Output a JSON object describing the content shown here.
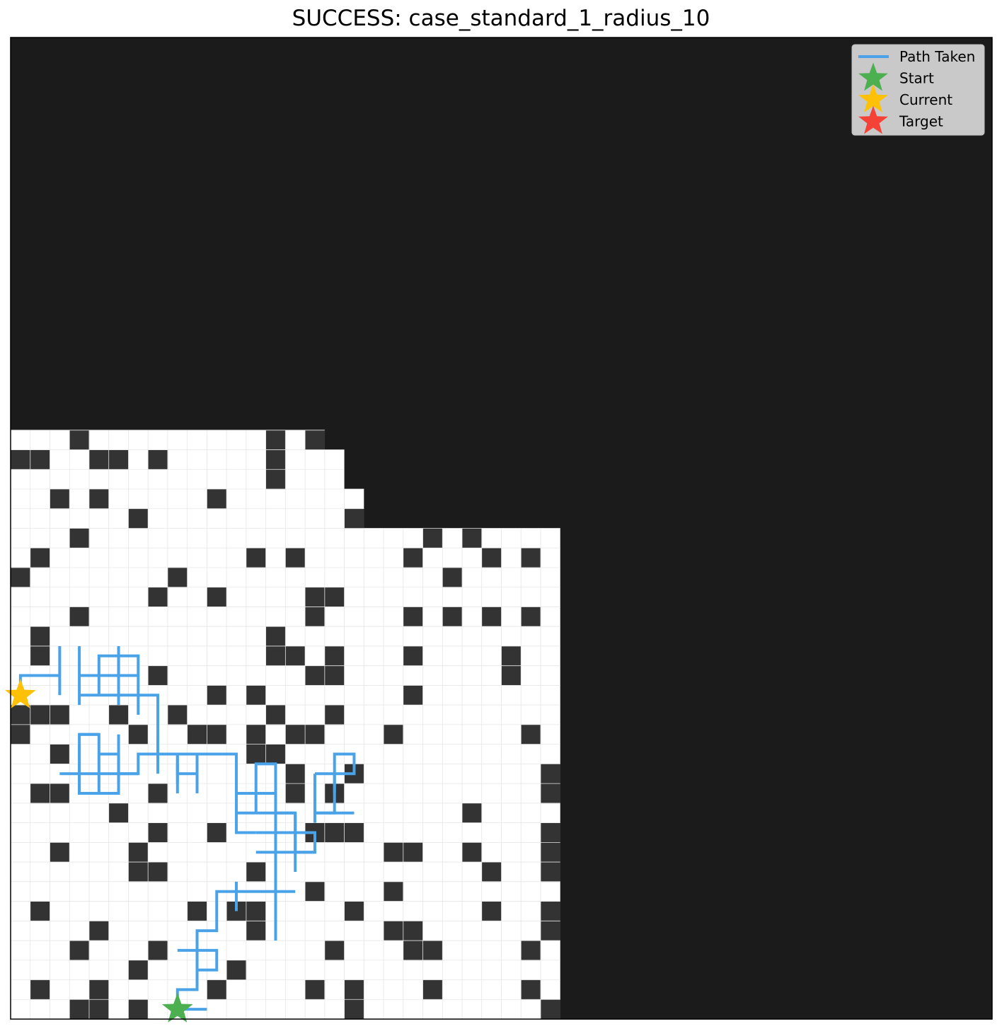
{
  "chart_data": {
    "type": "heatmap",
    "title": "SUCCESS: case_standard_1_radius_10",
    "grid_size": [
      50,
      50
    ],
    "grid": true,
    "legend_placement": "top-right",
    "legend": [
      {
        "label": "Path Taken",
        "kind": "line",
        "color": "#4aa3e8"
      },
      {
        "label": "Start",
        "kind": "star",
        "color": "#4caf50"
      },
      {
        "label": "Current",
        "kind": "star",
        "color": "#ffc107"
      },
      {
        "label": "Target",
        "kind": "star",
        "color": "#f44336"
      }
    ],
    "colors": {
      "unknown": "#1b1b1b",
      "free": "#ffffff",
      "obstacle": "#333333",
      "gridline": "#e6e6e6",
      "path": "#4aa3e8"
    },
    "revealed_rows": [
      {
        "row": 20,
        "end": 16
      },
      {
        "row": 21,
        "end": 17
      },
      {
        "row": 22,
        "end": 17
      },
      {
        "row": 23,
        "end": 18
      },
      {
        "row": 24,
        "end": 18
      },
      {
        "row": 25,
        "end": 28
      },
      {
        "row": 26,
        "end": 28
      },
      {
        "row": 27,
        "end": 28
      },
      {
        "row": 28,
        "end": 28
      },
      {
        "row": 29,
        "end": 28
      },
      {
        "row": 30,
        "end": 28
      },
      {
        "row": 31,
        "end": 28
      },
      {
        "row": 32,
        "end": 28
      },
      {
        "row": 33,
        "end": 28
      },
      {
        "row": 34,
        "end": 28
      },
      {
        "row": 35,
        "end": 28
      },
      {
        "row": 36,
        "end": 28
      },
      {
        "row": 37,
        "end": 28
      },
      {
        "row": 38,
        "end": 28
      },
      {
        "row": 39,
        "end": 28
      },
      {
        "row": 40,
        "end": 28
      },
      {
        "row": 41,
        "end": 28
      },
      {
        "row": 42,
        "end": 28
      },
      {
        "row": 43,
        "end": 28
      },
      {
        "row": 44,
        "end": 28
      },
      {
        "row": 45,
        "end": 28
      },
      {
        "row": 46,
        "end": 28
      },
      {
        "row": 47,
        "end": 28
      },
      {
        "row": 48,
        "end": 28
      },
      {
        "row": 49,
        "end": 28
      }
    ],
    "obstacles": [
      [
        20,
        3
      ],
      [
        20,
        13
      ],
      [
        20,
        15
      ],
      [
        21,
        0
      ],
      [
        21,
        1
      ],
      [
        21,
        4
      ],
      [
        21,
        5
      ],
      [
        21,
        7
      ],
      [
        21,
        13
      ],
      [
        22,
        13
      ],
      [
        23,
        2
      ],
      [
        23,
        4
      ],
      [
        23,
        10
      ],
      [
        24,
        6
      ],
      [
        24,
        17
      ],
      [
        25,
        3
      ],
      [
        25,
        21
      ],
      [
        25,
        23
      ],
      [
        26,
        1
      ],
      [
        26,
        12
      ],
      [
        26,
        14
      ],
      [
        26,
        20
      ],
      [
        26,
        24
      ],
      [
        26,
        26
      ],
      [
        27,
        0
      ],
      [
        27,
        8
      ],
      [
        27,
        22
      ],
      [
        28,
        7
      ],
      [
        28,
        10
      ],
      [
        28,
        15
      ],
      [
        28,
        16
      ],
      [
        29,
        3
      ],
      [
        29,
        15
      ],
      [
        29,
        20
      ],
      [
        29,
        22
      ],
      [
        29,
        24
      ],
      [
        29,
        26
      ],
      [
        30,
        1
      ],
      [
        30,
        13
      ],
      [
        31,
        1
      ],
      [
        31,
        13
      ],
      [
        31,
        14
      ],
      [
        31,
        16
      ],
      [
        31,
        20
      ],
      [
        31,
        25
      ],
      [
        32,
        7
      ],
      [
        32,
        15
      ],
      [
        32,
        16
      ],
      [
        32,
        25
      ],
      [
        33,
        10
      ],
      [
        33,
        12
      ],
      [
        33,
        20
      ],
      [
        34,
        0
      ],
      [
        34,
        1
      ],
      [
        34,
        2
      ],
      [
        34,
        5
      ],
      [
        34,
        8
      ],
      [
        34,
        13
      ],
      [
        34,
        16
      ],
      [
        35,
        0
      ],
      [
        35,
        6
      ],
      [
        35,
        9
      ],
      [
        35,
        10
      ],
      [
        35,
        12
      ],
      [
        35,
        14
      ],
      [
        35,
        15
      ],
      [
        35,
        19
      ],
      [
        35,
        26
      ],
      [
        36,
        2
      ],
      [
        36,
        12
      ],
      [
        36,
        13
      ],
      [
        37,
        14
      ],
      [
        37,
        17
      ],
      [
        37,
        27
      ],
      [
        38,
        1
      ],
      [
        38,
        2
      ],
      [
        38,
        7
      ],
      [
        38,
        14
      ],
      [
        38,
        16
      ],
      [
        38,
        27
      ],
      [
        39,
        5
      ],
      [
        39,
        23
      ],
      [
        40,
        7
      ],
      [
        40,
        10
      ],
      [
        40,
        15
      ],
      [
        40,
        16
      ],
      [
        40,
        17
      ],
      [
        40,
        27
      ],
      [
        41,
        2
      ],
      [
        41,
        6
      ],
      [
        41,
        19
      ],
      [
        41,
        20
      ],
      [
        41,
        23
      ],
      [
        41,
        27
      ],
      [
        42,
        6
      ],
      [
        42,
        7
      ],
      [
        42,
        12
      ],
      [
        42,
        24
      ],
      [
        42,
        27
      ],
      [
        43,
        15
      ],
      [
        43,
        19
      ],
      [
        44,
        1
      ],
      [
        44,
        9
      ],
      [
        44,
        11
      ],
      [
        44,
        12
      ],
      [
        44,
        17
      ],
      [
        44,
        24
      ],
      [
        44,
        27
      ],
      [
        45,
        4
      ],
      [
        45,
        12
      ],
      [
        45,
        19
      ],
      [
        45,
        20
      ],
      [
        45,
        27
      ],
      [
        46,
        3
      ],
      [
        46,
        7
      ],
      [
        46,
        16
      ],
      [
        46,
        20
      ],
      [
        46,
        21
      ],
      [
        46,
        26
      ],
      [
        47,
        6
      ],
      [
        47,
        11
      ],
      [
        48,
        1
      ],
      [
        48,
        4
      ],
      [
        48,
        10
      ],
      [
        48,
        15
      ],
      [
        48,
        17
      ],
      [
        48,
        21
      ],
      [
        48,
        26
      ],
      [
        49,
        3
      ],
      [
        49,
        4
      ],
      [
        49,
        6
      ],
      [
        49,
        17
      ],
      [
        49,
        27
      ]
    ],
    "path_segments": [
      [
        [
          8.5,
          49.5
        ],
        [
          10,
          49.5
        ]
      ],
      [
        [
          8.5,
          49.5
        ],
        [
          8.5,
          48.5
        ],
        [
          9.5,
          48.5
        ],
        [
          9.5,
          45.5
        ],
        [
          10.5,
          45.5
        ],
        [
          10.5,
          43.5
        ],
        [
          14.5,
          43.5
        ]
      ],
      [
        [
          9.5,
          45.5
        ],
        [
          9.5,
          47.5
        ],
        [
          10.5,
          47.5
        ],
        [
          10.5,
          46.5
        ],
        [
          8.5,
          46.5
        ]
      ],
      [
        [
          11.5,
          44.5
        ],
        [
          11.5,
          43
        ]
      ],
      [
        [
          13.5,
          43.5
        ],
        [
          13.5,
          46
        ]
      ],
      [
        [
          13.5,
          43.5
        ],
        [
          13.5,
          37
        ],
        [
          12.5,
          37
        ],
        [
          12.5,
          39.5
        ]
      ],
      [
        [
          14.5,
          42.5
        ],
        [
          14.5,
          39.5
        ],
        [
          13.5,
          39.5
        ],
        [
          13.5,
          38.5
        ],
        [
          11.5,
          38.5
        ],
        [
          11.5,
          40.5
        ],
        [
          12.5,
          40.5
        ]
      ],
      [
        [
          11.5,
          39.5
        ],
        [
          14.5,
          39.5
        ]
      ],
      [
        [
          12.5,
          41.5
        ],
        [
          15.5,
          41.5
        ]
      ],
      [
        [
          12.5,
          40.5
        ],
        [
          14.5,
          40.5
        ],
        [
          14.5,
          39.5
        ]
      ],
      [
        [
          15.5,
          37.5
        ],
        [
          15.5,
          40
        ]
      ],
      [
        [
          15.5,
          39.5
        ],
        [
          17.5,
          39.5
        ]
      ],
      [
        [
          11.5,
          38.5
        ],
        [
          11.5,
          36.5
        ],
        [
          8.5,
          36.5
        ],
        [
          8.5,
          37.5
        ],
        [
          9.5,
          37.5
        ],
        [
          9.5,
          36.5
        ],
        [
          7.5,
          36.5
        ]
      ],
      [
        [
          9.5,
          37.5
        ],
        [
          9.5,
          38.5
        ]
      ],
      [
        [
          8.5,
          37
        ],
        [
          8.5,
          38
        ]
      ],
      [
        [
          8.5,
          36.5
        ],
        [
          8.5,
          38.5
        ]
      ],
      [
        [
          7.5,
          36.5
        ],
        [
          6.5,
          36.5
        ],
        [
          6.5,
          37.5
        ],
        [
          2.5,
          37.5
        ]
      ],
      [
        [
          7.5,
          35.5
        ],
        [
          7.5,
          36.5
        ]
      ],
      [
        [
          5.5,
          37.5
        ],
        [
          5.5,
          38.5
        ],
        [
          3.5,
          38.5
        ],
        [
          3.5,
          36
        ]
      ],
      [
        [
          4.5,
          38.5
        ],
        [
          4.5,
          35.5
        ],
        [
          3.5,
          35.5
        ]
      ],
      [
        [
          4.5,
          35.5
        ],
        [
          3.5,
          35.5
        ],
        [
          3.5,
          38.5
        ],
        [
          4.5,
          38.5
        ]
      ],
      [
        [
          5.5,
          35.5
        ],
        [
          5.5,
          38
        ]
      ],
      [
        [
          4.5,
          36.5
        ],
        [
          5.5,
          36.5
        ],
        [
          5.5,
          37.5
        ],
        [
          6.5,
          37.5
        ]
      ],
      [
        [
          7.5,
          37.5
        ],
        [
          7.5,
          35.5
        ],
        [
          7.5,
          33.5
        ],
        [
          3.5,
          33.5
        ]
      ],
      [
        [
          6.5,
          34.5
        ],
        [
          6.5,
          32.5
        ],
        [
          6.5,
          31.5
        ],
        [
          4.5,
          31.5
        ],
        [
          4.5,
          33.5
        ]
      ],
      [
        [
          5.5,
          31.5
        ],
        [
          5.5,
          32.5
        ],
        [
          3.5,
          32.5
        ]
      ],
      [
        [
          5.5,
          31
        ],
        [
          5.5,
          34
        ]
      ],
      [
        [
          3.5,
          31
        ],
        [
          3.5,
          34
        ]
      ],
      [
        [
          2.5,
          31
        ],
        [
          2.5,
          33.5
        ]
      ],
      [
        [
          2.5,
          32.5
        ],
        [
          0.5,
          32.5
        ],
        [
          0.5,
          33.5
        ]
      ],
      [
        [
          3.5,
          32.5
        ],
        [
          6.5,
          32.5
        ]
      ],
      [
        [
          15.5,
          39.5
        ],
        [
          16.5,
          39.5
        ],
        [
          16.5,
          37.5
        ],
        [
          17.5,
          37.5
        ],
        [
          17.5,
          36.5
        ],
        [
          16.5,
          36.5
        ],
        [
          16.5,
          37.5
        ],
        [
          15.5,
          37.5
        ]
      ],
      [
        [
          16.5,
          37.5
        ],
        [
          16.5,
          38.5
        ]
      ],
      [
        [
          13.5,
          40.5
        ],
        [
          13.5,
          39.5
        ]
      ],
      [
        [
          14.5,
          41.5
        ],
        [
          15.5,
          41.5
        ],
        [
          15.5,
          40.5
        ],
        [
          14.5,
          40.5
        ],
        [
          14.5,
          41.5
        ]
      ]
    ],
    "start": {
      "row": 49.5,
      "col": 8.5
    },
    "current": {
      "row": 33.5,
      "col": 0.5
    }
  }
}
